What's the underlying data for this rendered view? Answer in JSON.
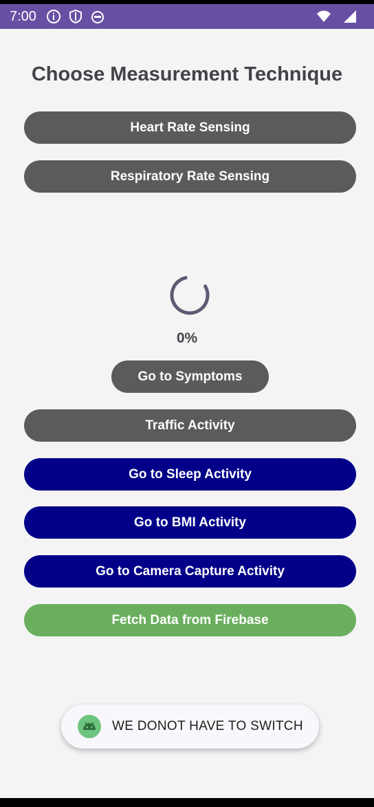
{
  "status_bar": {
    "time": "7:00",
    "icons_left": [
      "info-icon",
      "shield-icon",
      "android-debug-icon"
    ],
    "icons_right": [
      "wifi-icon",
      "signal-icon"
    ]
  },
  "title": "Choose Measurement Technique",
  "buttons": {
    "heart_rate": "Heart Rate Sensing",
    "respiratory_rate": "Respiratory Rate Sensing",
    "symptoms": "Go to Symptoms",
    "traffic": "Traffic Activity",
    "sleep": "Go to Sleep Activity",
    "bmi": "Go to BMI Activity",
    "camera": "Go to Camera Capture Activity",
    "firebase": "Fetch Data from Firebase"
  },
  "progress": {
    "label": "0%"
  },
  "toast": {
    "icon": "android-icon",
    "text": "WE DONOT HAVE TO SWITCH"
  },
  "colors": {
    "status_bar": "#6750a4",
    "gray_button": "#5b5b5b",
    "navy_button": "#020088",
    "green_button": "#6aaf5e",
    "background": "#f4f4f5"
  }
}
